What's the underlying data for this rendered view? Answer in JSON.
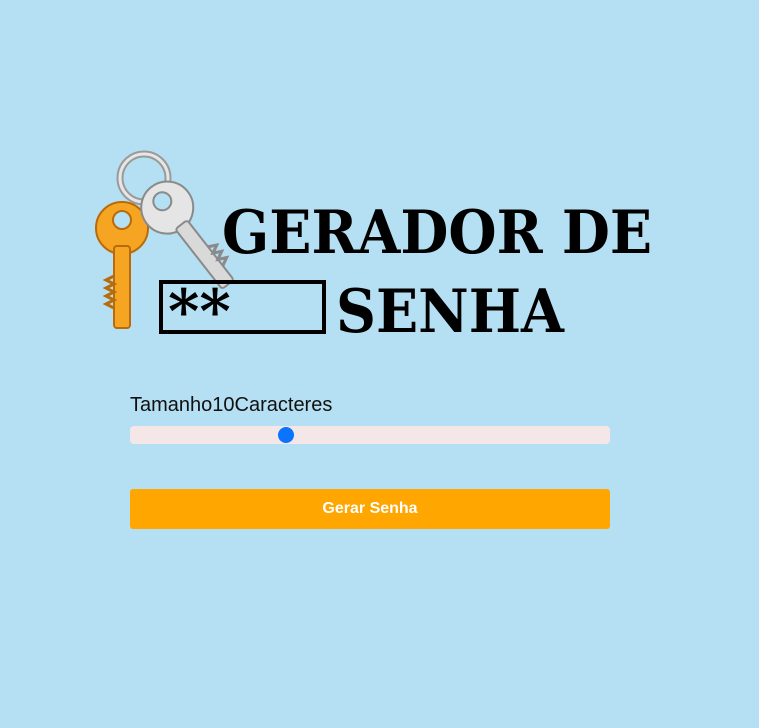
{
  "logo": {
    "line1": "GERADOR DE",
    "line2": "SENHA",
    "masked": "**",
    "icon": "keys-icon"
  },
  "slider": {
    "prefix": "Tamanho",
    "value": "10",
    "suffix": "Caracteres",
    "fraction": 0.32,
    "thumb_color": "#0a74ff",
    "track_color": "#f5e7e8"
  },
  "button": {
    "label": "Gerar Senha",
    "color": "#ffa600"
  },
  "background_color": "#b5dff2"
}
